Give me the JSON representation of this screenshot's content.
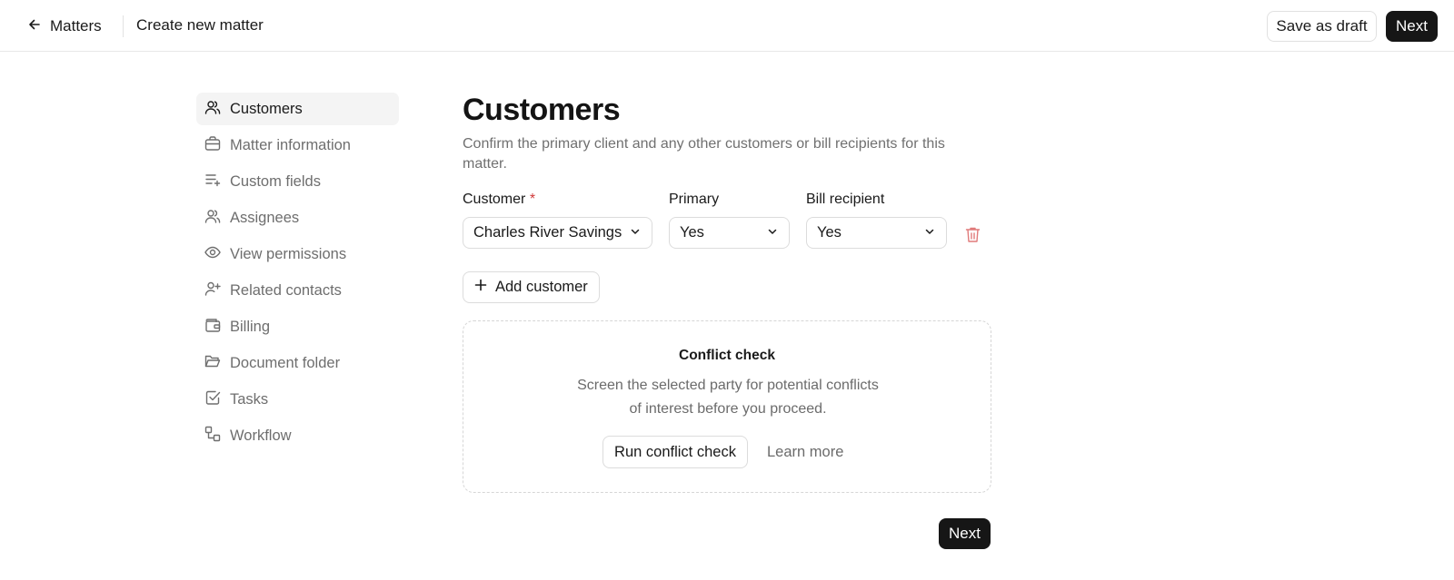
{
  "header": {
    "back_label": "Matters",
    "breadcrumb": "Create new matter",
    "save_draft_label": "Save as draft",
    "next_label": "Next"
  },
  "sidebar": {
    "items": [
      {
        "label": "Customers",
        "icon": "users-icon",
        "active": true
      },
      {
        "label": "Matter information",
        "icon": "briefcase-icon",
        "active": false
      },
      {
        "label": "Custom fields",
        "icon": "list-plus-icon",
        "active": false
      },
      {
        "label": "Assignees",
        "icon": "users-icon",
        "active": false
      },
      {
        "label": "View permissions",
        "icon": "eye-icon",
        "active": false
      },
      {
        "label": "Related contacts",
        "icon": "user-plus-icon",
        "active": false
      },
      {
        "label": "Billing",
        "icon": "wallet-icon",
        "active": false
      },
      {
        "label": "Document folder",
        "icon": "folder-open-icon",
        "active": false
      },
      {
        "label": "Tasks",
        "icon": "checkbox-icon",
        "active": false
      },
      {
        "label": "Workflow",
        "icon": "workflow-icon",
        "active": false
      }
    ]
  },
  "main": {
    "title": "Customers",
    "description": "Confirm the primary client and any other customers or bill recipients for this matter.",
    "fields": {
      "customer_label": "Customer",
      "required_mark": "*",
      "primary_label": "Primary",
      "bill_recipient_label": "Bill recipient"
    },
    "row": {
      "customer_value": "Charles River Savings",
      "primary_value": "Yes",
      "bill_recipient_value": "Yes"
    },
    "add_customer_label": "Add customer",
    "conflict_check": {
      "title": "Conflict check",
      "body": "Screen the selected party for potential conflicts of interest before you proceed.",
      "run_label": "Run conflict check",
      "learn_more_label": "Learn more"
    },
    "next_label": "Next"
  },
  "colors": {
    "primary_button": "#161616",
    "required": "#d03a3a",
    "delete_icon": "#e07a7a",
    "muted_text": "#6e6e6e"
  }
}
